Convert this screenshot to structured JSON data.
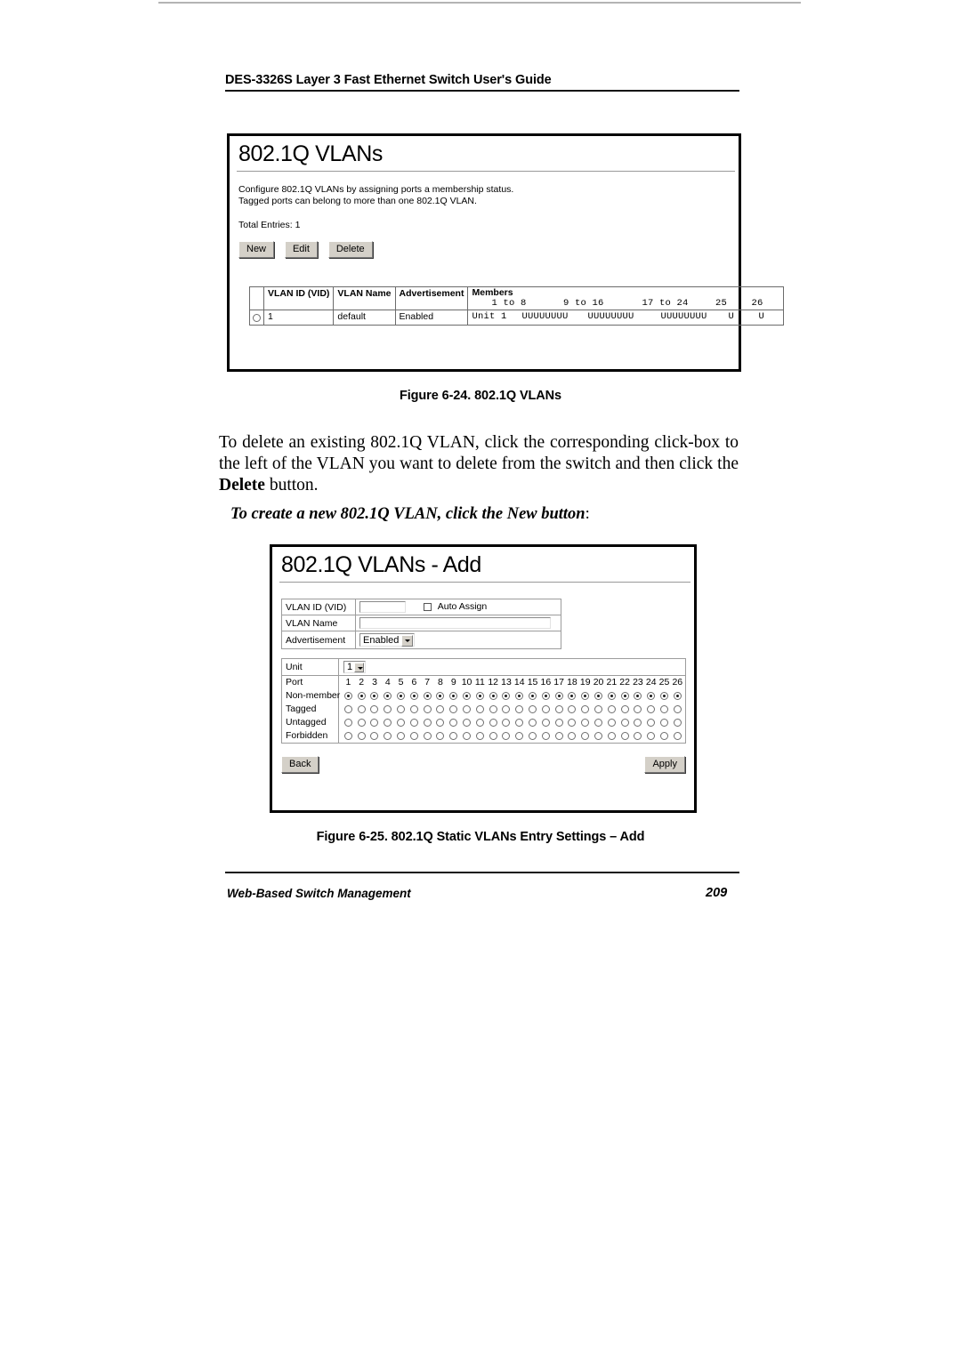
{
  "header": {
    "title": "DES-3326S Layer 3 Fast Ethernet Switch User's Guide"
  },
  "figure_list": {
    "window_title": "802.1Q VLANs",
    "description_line1": "Configure 802.1Q VLANs by assigning ports a membership status.",
    "description_line2": "Tagged ports can belong to more than one 802.1Q VLAN.",
    "total_entries": "Total Entries: 1",
    "buttons": {
      "new": "New",
      "edit": "Edit",
      "delete": "Delete"
    },
    "table": {
      "headers": {
        "select": "",
        "vlan_id": "VLAN ID (VID)",
        "vlan_name": "VLAN Name",
        "advertisement": "Advertisement",
        "members": "Members"
      },
      "member_ranges": [
        "1  to   8",
        "9   to 16",
        "17 to 24",
        "25",
        "26"
      ],
      "rows": [
        {
          "vlan_id": "1",
          "vlan_name": "default",
          "advertisement": "Enabled",
          "unit": "Unit 1",
          "members": [
            "UUUUUUUU",
            "UUUUUUUU",
            "UUUUUUUU",
            "U",
            "U"
          ]
        }
      ]
    },
    "caption": "Figure 6-24.  802.1Q VLANs"
  },
  "body_paragraph": {
    "part1": "To delete an existing 802.1Q VLAN, click the corresponding click-box to the left of the VLAN you want to delete from the switch and then click the ",
    "bold": "Delete",
    "part2": " button."
  },
  "lead_in": {
    "text": "To create a new 802.1Q VLAN, click the New button",
    "tail": ":"
  },
  "figure_add": {
    "window_title": "802.1Q VLANs - Add",
    "fields": [
      {
        "label": "VLAN ID (VID)",
        "value": "",
        "extra_label": "Auto Assign"
      },
      {
        "label": "VLAN Name",
        "value": ""
      },
      {
        "label": "Advertisement",
        "value": "Enabled"
      }
    ],
    "unit_label": "Unit",
    "unit_value": "1",
    "port_label": "Port",
    "membership_rows": [
      "Non-member",
      "Tagged",
      "Untagged",
      "Forbidden"
    ],
    "ports": [
      "1",
      "2",
      "3",
      "4",
      "5",
      "6",
      "7",
      "8",
      "9",
      "10",
      "11",
      "12",
      "13",
      "14",
      "15",
      "16",
      "17",
      "18",
      "19",
      "20",
      "21",
      "22",
      "23",
      "24",
      "25",
      "26"
    ],
    "selected_row": "Non-member",
    "buttons": {
      "back": "Back",
      "apply": "Apply"
    },
    "caption": "Figure 6-25.  802.1Q Static VLANs Entry Settings – Add"
  },
  "footer": {
    "section": "Web-Based Switch Management",
    "page_number": "209"
  }
}
